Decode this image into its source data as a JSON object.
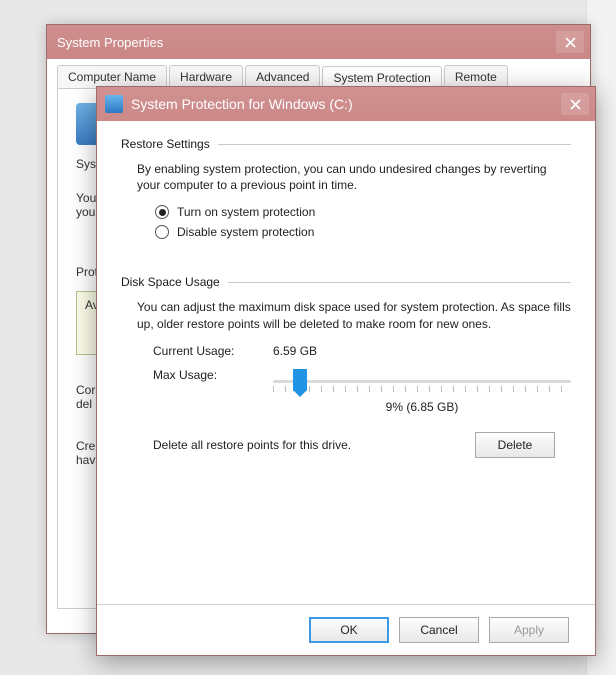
{
  "parent": {
    "title": "System Properties",
    "tabs": [
      "Computer Name",
      "Hardware",
      "Advanced",
      "System Protection",
      "Remote"
    ],
    "active_tab_index": 3,
    "line1_prefix": "Syste",
    "line2a": "You",
    "line2b": "your",
    "line3": "Prote",
    "avail": "Av",
    "conf1": "Cor",
    "conf2": "del",
    "create1": "Cre",
    "create2": "hav"
  },
  "dialog": {
    "title": "System Protection for Windows (C:)",
    "restore": {
      "header": "Restore Settings",
      "desc": "By enabling system protection, you can undo undesired changes by reverting your computer to a previous point in time.",
      "option_on": "Turn on system protection",
      "option_off": "Disable system protection",
      "selected": "on"
    },
    "disk": {
      "header": "Disk Space Usage",
      "desc": "You can adjust the maximum disk space used for system protection. As space fills up, older restore points will be deleted to make room for new ones.",
      "current_label": "Current Usage:",
      "current_value": "6.59 GB",
      "max_label": "Max Usage:",
      "slider_percent": 9,
      "slider_display": "9% (6.85 GB)",
      "delete_text": "Delete all restore points for this drive.",
      "delete_btn": "Delete"
    },
    "buttons": {
      "ok": "OK",
      "cancel": "Cancel",
      "apply": "Apply"
    }
  }
}
